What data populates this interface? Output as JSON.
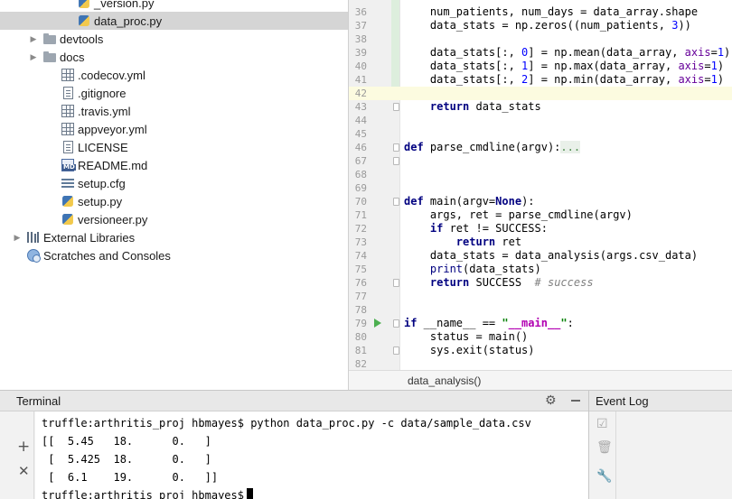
{
  "project_tree": {
    "items": [
      {
        "label": "_version.py",
        "icon": "python-file-icon",
        "arrow": ""
      },
      {
        "label": "data_proc.py",
        "icon": "python-file-icon",
        "arrow": "",
        "selected": true
      },
      {
        "label": "devtools",
        "icon": "folder-icon",
        "arrow": "▶"
      },
      {
        "label": "docs",
        "icon": "folder-icon",
        "arrow": "▶"
      },
      {
        "label": ".codecov.yml",
        "icon": "yaml-file-icon",
        "arrow": ""
      },
      {
        "label": ".gitignore",
        "icon": "text-file-icon",
        "arrow": ""
      },
      {
        "label": ".travis.yml",
        "icon": "yaml-file-icon",
        "arrow": ""
      },
      {
        "label": "appveyor.yml",
        "icon": "yaml-file-icon",
        "arrow": ""
      },
      {
        "label": "LICENSE",
        "icon": "text-file-icon",
        "arrow": ""
      },
      {
        "label": "README.md",
        "icon": "markdown-file-icon",
        "arrow": ""
      },
      {
        "label": "setup.cfg",
        "icon": "config-file-icon",
        "arrow": ""
      },
      {
        "label": "setup.py",
        "icon": "python-file-icon",
        "arrow": ""
      },
      {
        "label": "versioneer.py",
        "icon": "python-file-icon",
        "arrow": ""
      },
      {
        "label": "External Libraries",
        "icon": "library-icon",
        "arrow": "▶"
      },
      {
        "label": "Scratches and Consoles",
        "icon": "scratch-icon",
        "arrow": ""
      }
    ]
  },
  "editor": {
    "lines": [
      {
        "n": "36",
        "html": "    num_patients, num_days = data_array.shape"
      },
      {
        "n": "37",
        "html": "    data_stats = np.zeros((num_patients, <span class=\"num\">3</span>))"
      },
      {
        "n": "38",
        "html": ""
      },
      {
        "n": "39",
        "html": "    data_stats[:, <span class=\"num\">0</span>] = np.mean(data_array, <span class=\"named\">axis</span>=<span class=\"num\">1</span>)"
      },
      {
        "n": "40",
        "html": "    data_stats[:, <span class=\"num\">1</span>] = np.max(data_array, <span class=\"named\">axis</span>=<span class=\"num\">1</span>)"
      },
      {
        "n": "41",
        "html": "    data_stats[:, <span class=\"num\">2</span>] = np.min(data_array, <span class=\"named\">axis</span>=<span class=\"num\">1</span>)"
      },
      {
        "n": "42",
        "html": "",
        "current": true
      },
      {
        "n": "43",
        "html": "    <span class=\"kw\">return</span> data_stats"
      },
      {
        "n": "44",
        "html": ""
      },
      {
        "n": "45",
        "html": ""
      },
      {
        "n": "46",
        "html": "<span class=\"kw\">def</span> parse_cmdline(argv):<span class=\"fold\">...</span>"
      },
      {
        "n": "67",
        "html": ""
      },
      {
        "n": "68",
        "html": ""
      },
      {
        "n": "69",
        "html": ""
      },
      {
        "n": "70",
        "html": "<span class=\"kw\">def</span> main(argv=<span class=\"kw\">None</span>):"
      },
      {
        "n": "71",
        "html": "    args, ret = parse_cmdline(argv)"
      },
      {
        "n": "72",
        "html": "    <span class=\"kw\">if</span> ret != SUCCESS:"
      },
      {
        "n": "73",
        "html": "        <span class=\"kw\">return</span> ret"
      },
      {
        "n": "74",
        "html": "    data_stats = data_analysis(args.csv_data)"
      },
      {
        "n": "75",
        "html": "    <span class=\"builtin\">print</span>(data_stats)"
      },
      {
        "n": "76",
        "html": "    <span class=\"kw\">return</span> SUCCESS  <span class=\"cmt\"># success</span>"
      },
      {
        "n": "77",
        "html": ""
      },
      {
        "n": "78",
        "html": ""
      },
      {
        "n": "79",
        "html": "<span class=\"kw\">if</span> __name__ == <span class=\"str\">\"<span class=\"mag\">__main__</span>\"</span>:",
        "run": true
      },
      {
        "n": "80",
        "html": "    status = main()"
      },
      {
        "n": "81",
        "html": "    sys.exit(status)"
      },
      {
        "n": "82",
        "html": ""
      }
    ],
    "breadcrumb": "data_analysis()"
  },
  "terminal": {
    "title": "Terminal",
    "lines": [
      "truffle:arthritis_proj hbmayes$ python data_proc.py -c data/sample_data.csv",
      "[[  5.45   18.      0.   ]",
      " [  5.425  18.      0.   ]",
      " [  6.1    19.      0.   ]]"
    ],
    "prompt": "truffle:arthritis_proj hbmayes$",
    "plus": "+",
    "close": "✕",
    "gear": "⚙"
  },
  "event_log": {
    "title": "Event Log"
  }
}
